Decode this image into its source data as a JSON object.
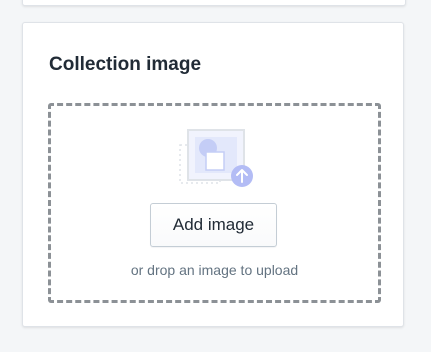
{
  "card": {
    "title": "Collection image"
  },
  "dropzone": {
    "button_label": "Add image",
    "hint": "or drop an image to upload",
    "illustration_icon": "image-upload-icon",
    "upload_arrow_icon": "arrow-up-icon"
  },
  "colors": {
    "page_background": "#f4f6f8",
    "card_background": "#ffffff",
    "dropzone_border": "#8c9196",
    "illustration_accent": "#b3bcf5",
    "text_primary": "#212b36",
    "text_subdued": "#637381"
  }
}
